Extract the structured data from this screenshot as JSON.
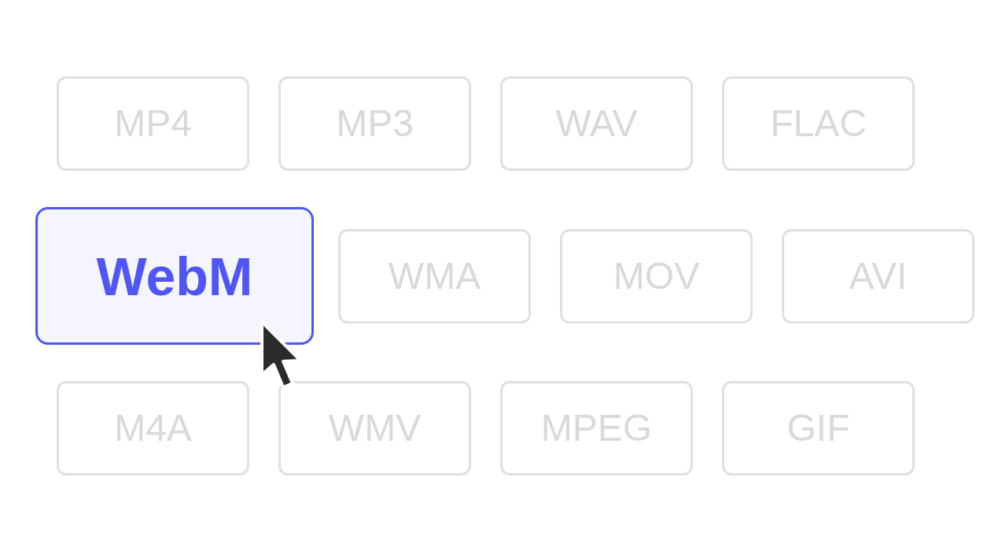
{
  "rows": [
    {
      "items": [
        {
          "label": "MP4",
          "selected": false
        },
        {
          "label": "MP3",
          "selected": false
        },
        {
          "label": "WAV",
          "selected": false
        },
        {
          "label": "FLAC",
          "selected": false
        }
      ]
    },
    {
      "items": [
        {
          "label": "WebM",
          "selected": true
        },
        {
          "label": "WMA",
          "selected": false
        },
        {
          "label": "MOV",
          "selected": false
        },
        {
          "label": "AVI",
          "selected": false
        }
      ]
    },
    {
      "items": [
        {
          "label": "M4A",
          "selected": false
        },
        {
          "label": "WMV",
          "selected": false
        },
        {
          "label": "MPEG",
          "selected": false
        },
        {
          "label": "GIF",
          "selected": false
        }
      ]
    }
  ]
}
